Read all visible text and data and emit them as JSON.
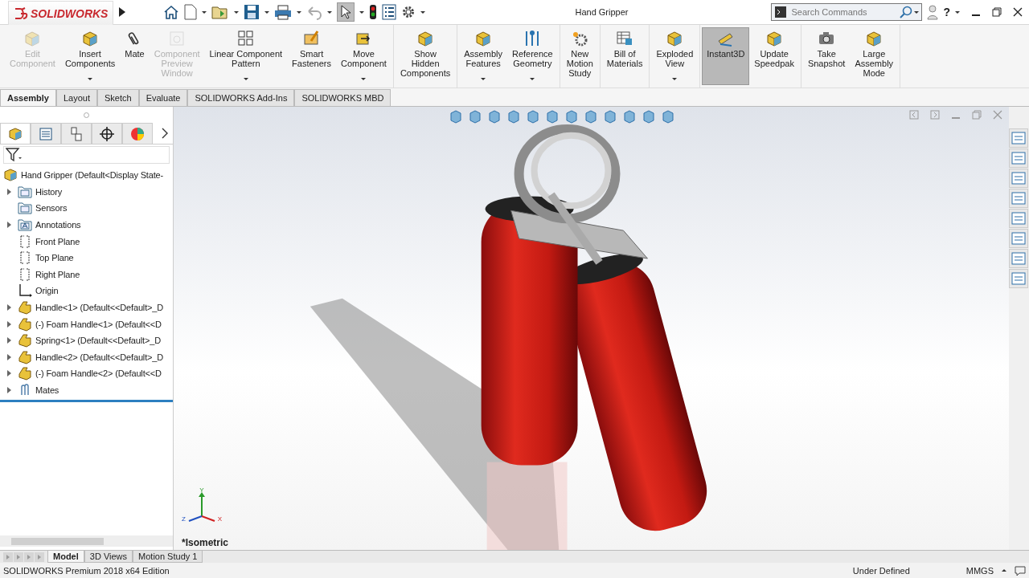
{
  "app": {
    "logo": "SOLIDWORKS",
    "title": "Hand Gripper",
    "search": {
      "placeholder": "Search Commands"
    },
    "help": "?"
  },
  "ribbon": {
    "groups": [
      {
        "buttons": [
          {
            "label": "Edit\nComponent",
            "disabled": true,
            "selected": false,
            "dropdown": false
          },
          {
            "label": "Insert\nComponents",
            "disabled": false,
            "selected": false,
            "dropdown": true
          },
          {
            "label": "Mate",
            "disabled": false,
            "selected": false,
            "dropdown": false
          },
          {
            "label": "Component\nPreview\nWindow",
            "disabled": true,
            "selected": false,
            "dropdown": false
          },
          {
            "label": "Linear Component\nPattern",
            "disabled": false,
            "selected": false,
            "dropdown": true
          },
          {
            "label": "Smart\nFasteners",
            "disabled": false,
            "selected": false,
            "dropdown": false
          },
          {
            "label": "Move\nComponent",
            "disabled": false,
            "selected": false,
            "dropdown": true
          }
        ]
      },
      {
        "buttons": [
          {
            "label": "Show\nHidden\nComponents",
            "disabled": false,
            "selected": false,
            "dropdown": false
          }
        ]
      },
      {
        "buttons": [
          {
            "label": "Assembly\nFeatures",
            "disabled": false,
            "selected": false,
            "dropdown": true
          },
          {
            "label": "Reference\nGeometry",
            "disabled": false,
            "selected": false,
            "dropdown": true
          }
        ]
      },
      {
        "buttons": [
          {
            "label": "New\nMotion\nStudy",
            "disabled": false,
            "selected": false,
            "dropdown": false
          }
        ]
      },
      {
        "buttons": [
          {
            "label": "Bill of\nMaterials",
            "disabled": false,
            "selected": false,
            "dropdown": false
          }
        ]
      },
      {
        "buttons": [
          {
            "label": "Exploded\nView",
            "disabled": false,
            "selected": false,
            "dropdown": true
          }
        ]
      },
      {
        "buttons": [
          {
            "label": "Instant3D",
            "disabled": false,
            "selected": true,
            "dropdown": false
          },
          {
            "label": "Update\nSpeedpak",
            "disabled": false,
            "selected": false,
            "dropdown": false
          }
        ]
      },
      {
        "buttons": [
          {
            "label": "Take\nSnapshot",
            "disabled": false,
            "selected": false,
            "dropdown": false
          },
          {
            "label": "Large\nAssembly\nMode",
            "disabled": false,
            "selected": false,
            "dropdown": false
          }
        ]
      }
    ]
  },
  "tabs": [
    {
      "label": "Assembly",
      "selected": true
    },
    {
      "label": "Layout",
      "selected": false
    },
    {
      "label": "Sketch",
      "selected": false
    },
    {
      "label": "Evaluate",
      "selected": false
    },
    {
      "label": "SOLIDWORKS Add-Ins",
      "selected": false
    },
    {
      "label": "SOLIDWORKS MBD",
      "selected": false
    }
  ],
  "panel_tabs": [
    {
      "selected": true
    },
    {
      "selected": false
    },
    {
      "selected": false
    },
    {
      "selected": false
    },
    {
      "selected": false
    }
  ],
  "tree": {
    "label": "Hand Gripper  (Default<Display State-",
    "kind": "assembly",
    "children": [
      {
        "label": "History",
        "kind": "folder",
        "expanded": false
      },
      {
        "label": "Sensors",
        "kind": "folder"
      },
      {
        "label": "Annotations",
        "kind": "annotations",
        "expanded": false
      },
      {
        "label": "Front Plane",
        "kind": "plane"
      },
      {
        "label": "Top Plane",
        "kind": "plane"
      },
      {
        "label": "Right Plane",
        "kind": "plane"
      },
      {
        "label": "Origin",
        "kind": "origin"
      },
      {
        "label": "Handle<1> (Default<<Default>_D",
        "kind": "part",
        "expanded": false
      },
      {
        "label": "(-) Foam Handle<1> (Default<<D",
        "kind": "part",
        "expanded": false
      },
      {
        "label": "Spring<1> (Default<<Default>_D",
        "kind": "part",
        "expanded": false
      },
      {
        "label": "Handle<2> (Default<<Default>_D",
        "kind": "part",
        "expanded": false
      },
      {
        "label": "(-) Foam Handle<2> (Default<<D",
        "kind": "part",
        "expanded": false
      },
      {
        "label": "Mates",
        "kind": "mates",
        "expanded": false
      }
    ]
  },
  "viewport": {
    "view_name": "*Isometric",
    "triad": {
      "x": "X",
      "y": "Y",
      "z": "Z"
    }
  },
  "bottom_tabs": [
    {
      "label": "Model",
      "selected": true
    },
    {
      "label": "3D Views",
      "selected": false
    },
    {
      "label": "Motion Study 1",
      "selected": false
    }
  ],
  "status_bar": {
    "edition": "SOLIDWORKS Premium 2018 x64 Edition",
    "state": "Under Defined",
    "units": "MMGS"
  }
}
